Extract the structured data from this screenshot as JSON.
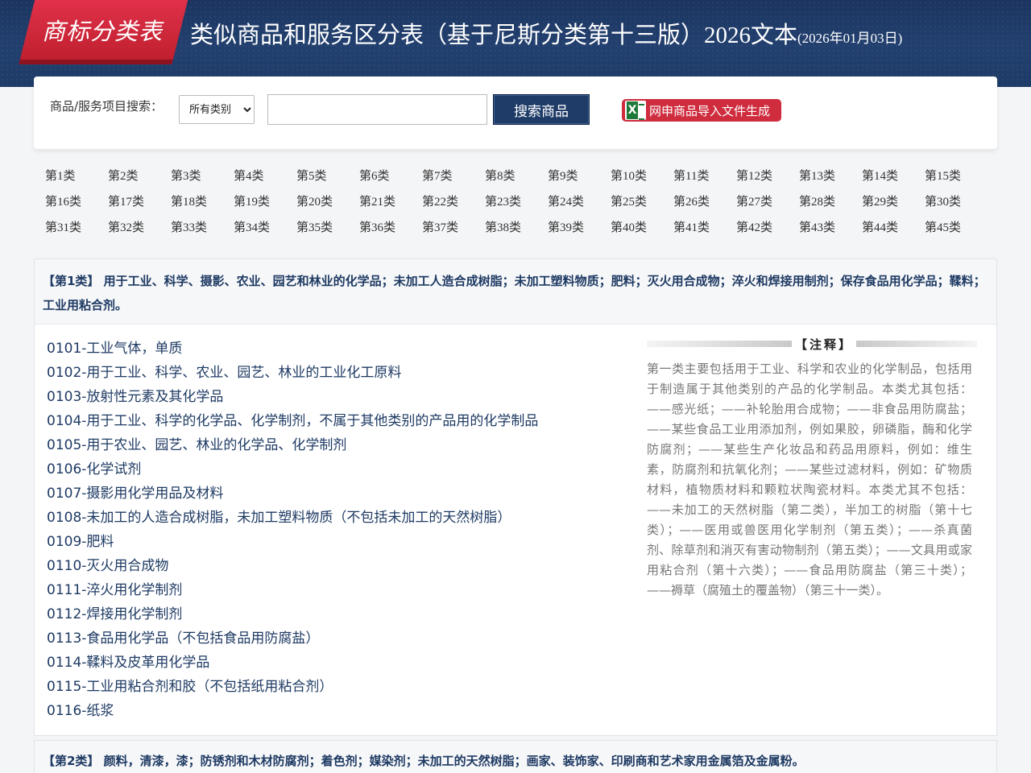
{
  "header": {
    "logo_text": "商标分类表",
    "title": "类似商品和服务区分表（基于尼斯分类第十三版）2026文本",
    "date": "(2026年01月03日)"
  },
  "search": {
    "label": "商品/服务项目搜索：",
    "category_selected": "所有类别",
    "input_value": "",
    "search_button": "搜索商品",
    "import_button": "网申商品导入文件生成"
  },
  "classes": [
    "第1类",
    "第2类",
    "第3类",
    "第4类",
    "第5类",
    "第6类",
    "第7类",
    "第8类",
    "第9类",
    "第10类",
    "第11类",
    "第12类",
    "第13类",
    "第14类",
    "第15类",
    "第16类",
    "第17类",
    "第18类",
    "第19类",
    "第20类",
    "第21类",
    "第22类",
    "第23类",
    "第24类",
    "第25类",
    "第26类",
    "第27类",
    "第28类",
    "第29类",
    "第30类",
    "第31类",
    "第32类",
    "第33类",
    "第34类",
    "第35类",
    "第36类",
    "第37类",
    "第38类",
    "第39类",
    "第40类",
    "第41类",
    "第42类",
    "第43类",
    "第44类",
    "第45类"
  ],
  "class1": {
    "heading": "【第1类】 用于工业、科学、摄影、农业、园艺和林业的化学品；未加工人造合成树脂；未加工塑料物质；肥料；灭火用合成物；淬火和焊接用制剂；保存食品用化学品；鞣料；工业用粘合剂。",
    "groups": [
      "0101-工业气体，单质",
      "0102-用于工业、科学、农业、园艺、林业的工业化工原料",
      "0103-放射性元素及其化学品",
      "0104-用于工业、科学的化学品、化学制剂，不属于其他类别的产品用的化学制品",
      "0105-用于农业、园艺、林业的化学品、化学制剂",
      "0106-化学试剂",
      "0107-摄影用化学用品及材料",
      "0108-未加工的人造合成树脂，未加工塑料物质（不包括未加工的天然树脂）",
      "0109-肥料",
      "0110-灭火用合成物",
      "0111-淬火用化学制剂",
      "0112-焊接用化学制剂",
      "0113-食品用化学品（不包括食品用防腐盐）",
      "0114-鞣料及皮革用化学品",
      "0115-工业用粘合剂和胶（不包括纸用粘合剂）",
      "0116-纸浆"
    ],
    "note_title": "【注释】",
    "note_text": "第一类主要包括用于工业、科学和农业的化学制品，包括用于制造属于其他类别的产品的化学制品。本类尤其包括：——感光纸；——补轮胎用合成物；——非食品用防腐盐；——某些食品工业用添加剂，例如果胶，卵磷脂，酶和化学防腐剂；——某些生产化妆品和药品用原料，例如：维生素，防腐剂和抗氧化剂；——某些过滤材料，例如：矿物质材料，植物质材料和颗粒状陶瓷材料。本类尤其不包括：——未加工的天然树脂（第二类），半加工的树脂（第十七类）；——医用或兽医用化学制剂（第五类）；——杀真菌剂、除草剂和消灭有害动物制剂（第五类）；——文具用或家用粘合剂（第十六类）；——食品用防腐盐（第三十类）；——褥草（腐殖土的覆盖物）（第三十一类）。"
  },
  "class2": {
    "heading": "【第2类】 颜料，清漆，漆；防锈剂和木材防腐剂；着色剂；媒染剂；未加工的天然树脂；画家、装饰家、印刷商和艺术家用金属箔及金属粉。"
  }
}
